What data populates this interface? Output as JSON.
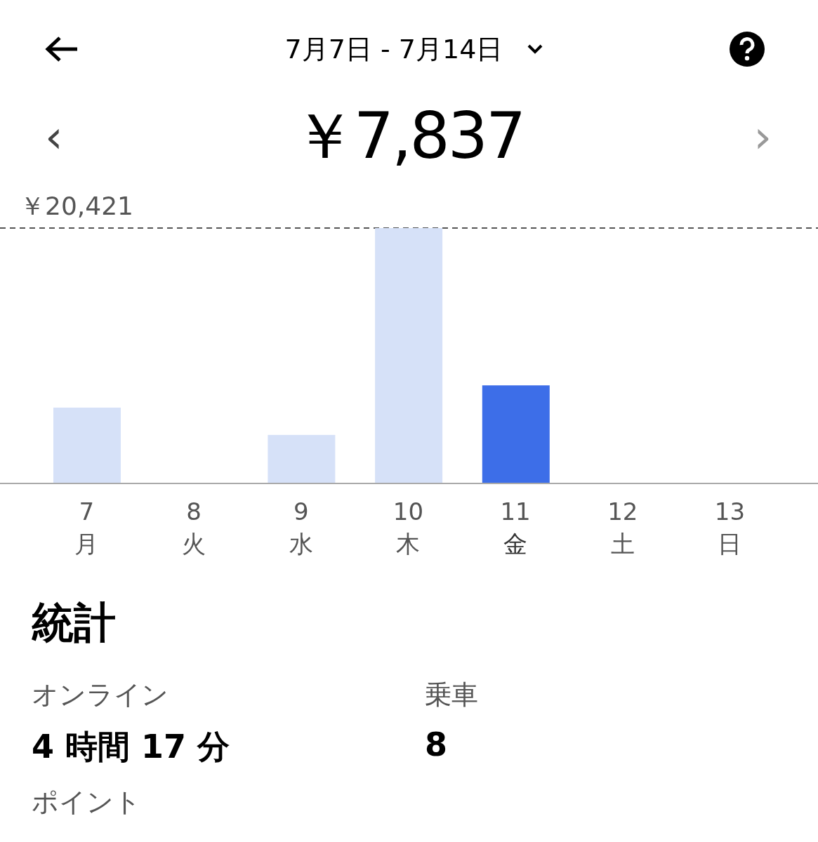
{
  "header": {
    "title": "7月7日 - 7月14日"
  },
  "summary": {
    "prev": "‹",
    "amount": "￥7,837",
    "next": "›"
  },
  "chart": {
    "max_label": "￥20,421",
    "days": [
      {
        "day": "7",
        "weekday": "月",
        "selected": false
      },
      {
        "day": "8",
        "weekday": "火",
        "selected": false
      },
      {
        "day": "9",
        "weekday": "水",
        "selected": false
      },
      {
        "day": "10",
        "weekday": "木",
        "selected": false
      },
      {
        "day": "11",
        "weekday": "金",
        "selected": true
      },
      {
        "day": "12",
        "weekday": "土",
        "selected": false
      },
      {
        "day": "13",
        "weekday": "日",
        "selected": false
      }
    ]
  },
  "stats": {
    "title": "統計",
    "items": [
      {
        "label": "オンライン",
        "value": "4 時間 17 分"
      },
      {
        "label": "乗車",
        "value": "8"
      }
    ],
    "next_label": "ポイント"
  }
}
